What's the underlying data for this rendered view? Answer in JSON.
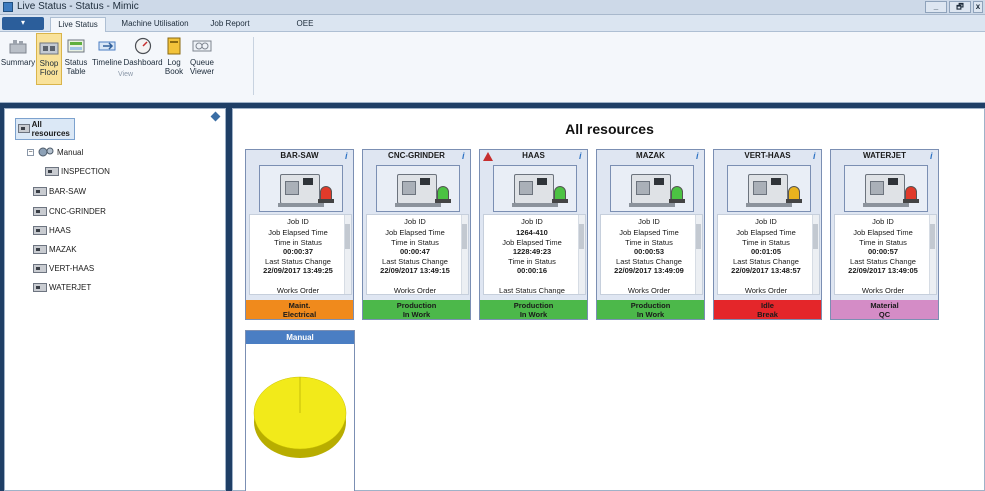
{
  "window": {
    "title": "Live Status - Status - Mimic",
    "controls": [
      "_",
      "🗗",
      "x"
    ]
  },
  "ribbon": {
    "tabs": [
      "Live Status",
      "Machine Utilisation",
      "Job Report",
      "OEE"
    ],
    "active_tab": "Live Status",
    "tools": [
      {
        "label": "Summary",
        "icon": "summary-icon"
      },
      {
        "label": "Shop Floor",
        "icon": "shop-floor-icon",
        "selected": true
      },
      {
        "label": "Status Table",
        "icon": "status-table-icon"
      },
      {
        "label": "Timeline",
        "icon": "timeline-icon"
      },
      {
        "label": "Dashboard",
        "icon": "dashboard-gauge-icon"
      },
      {
        "label": "Log Book",
        "icon": "log-book-icon"
      },
      {
        "label": "Queue Viewer",
        "icon": "queue-viewer-icon"
      }
    ],
    "group_label": "View"
  },
  "tree": {
    "root": "All resources",
    "group": "Manual",
    "group_children": [
      "INSPECTION"
    ],
    "items": [
      "BAR-SAW",
      "CNC-GRINDER",
      "HAAS",
      "MAZAK",
      "VERT-HAAS",
      "WATERJET"
    ]
  },
  "main": {
    "title": "All resources",
    "cards": [
      {
        "name": "BAR-SAW",
        "warning": false,
        "lamp_color": "#e03a2a",
        "lines": [
          "Job ID",
          "Job Elapsed Time",
          "Time in Status",
          "00:00:37",
          "Last Status Change",
          "22/09/2017 13:49:25",
          "Works Order"
        ],
        "status_line1": "Maint.",
        "status_line2": "Electrical",
        "status_color": "#f08a1c"
      },
      {
        "name": "CNC-GRINDER",
        "warning": false,
        "lamp_color": "#4cc243",
        "lines": [
          "Job ID",
          "Job Elapsed Time",
          "Time in Status",
          "00:00:47",
          "Last Status Change",
          "22/09/2017 13:49:15",
          "Works Order"
        ],
        "status_line1": "Production",
        "status_line2": "In Work",
        "status_color": "#4cb84a"
      },
      {
        "name": "HAAS",
        "warning": true,
        "lamp_color": "#4cc243",
        "lines": [
          "Job ID",
          "1264-410",
          "Job Elapsed Time",
          "1228:49:23",
          "Time in Status",
          "00:00:16",
          "Last Status Change"
        ],
        "status_line1": "Production",
        "status_line2": "In Work",
        "status_color": "#4cb84a"
      },
      {
        "name": "MAZAK",
        "warning": false,
        "lamp_color": "#4cc243",
        "lines": [
          "Job ID",
          "Job Elapsed Time",
          "Time in Status",
          "00:00:53",
          "Last Status Change",
          "22/09/2017 13:49:09",
          "Works Order"
        ],
        "status_line1": "Production",
        "status_line2": "In Work",
        "status_color": "#4cb84a"
      },
      {
        "name": "VERT-HAAS",
        "warning": false,
        "lamp_color": "#e8b21e",
        "lines": [
          "Job ID",
          "Job Elapsed Time",
          "Time in Status",
          "00:01:05",
          "Last Status Change",
          "22/09/2017 13:48:57",
          "Works Order"
        ],
        "status_line1": "Idle",
        "status_line2": "Break",
        "status_color": "#e4262a"
      },
      {
        "name": "WATERJET",
        "warning": false,
        "lamp_color": "#e03a2a",
        "lines": [
          "Job ID",
          "Job Elapsed Time",
          "Time in Status",
          "00:00:57",
          "Last Status Change",
          "22/09/2017 13:49:05",
          "Works Order"
        ],
        "status_line1": "Material",
        "status_line2": "QC",
        "status_color": "#d48cc6"
      }
    ],
    "manual_card": {
      "title": "Manual",
      "pie_color": "#f2ea1a"
    }
  }
}
